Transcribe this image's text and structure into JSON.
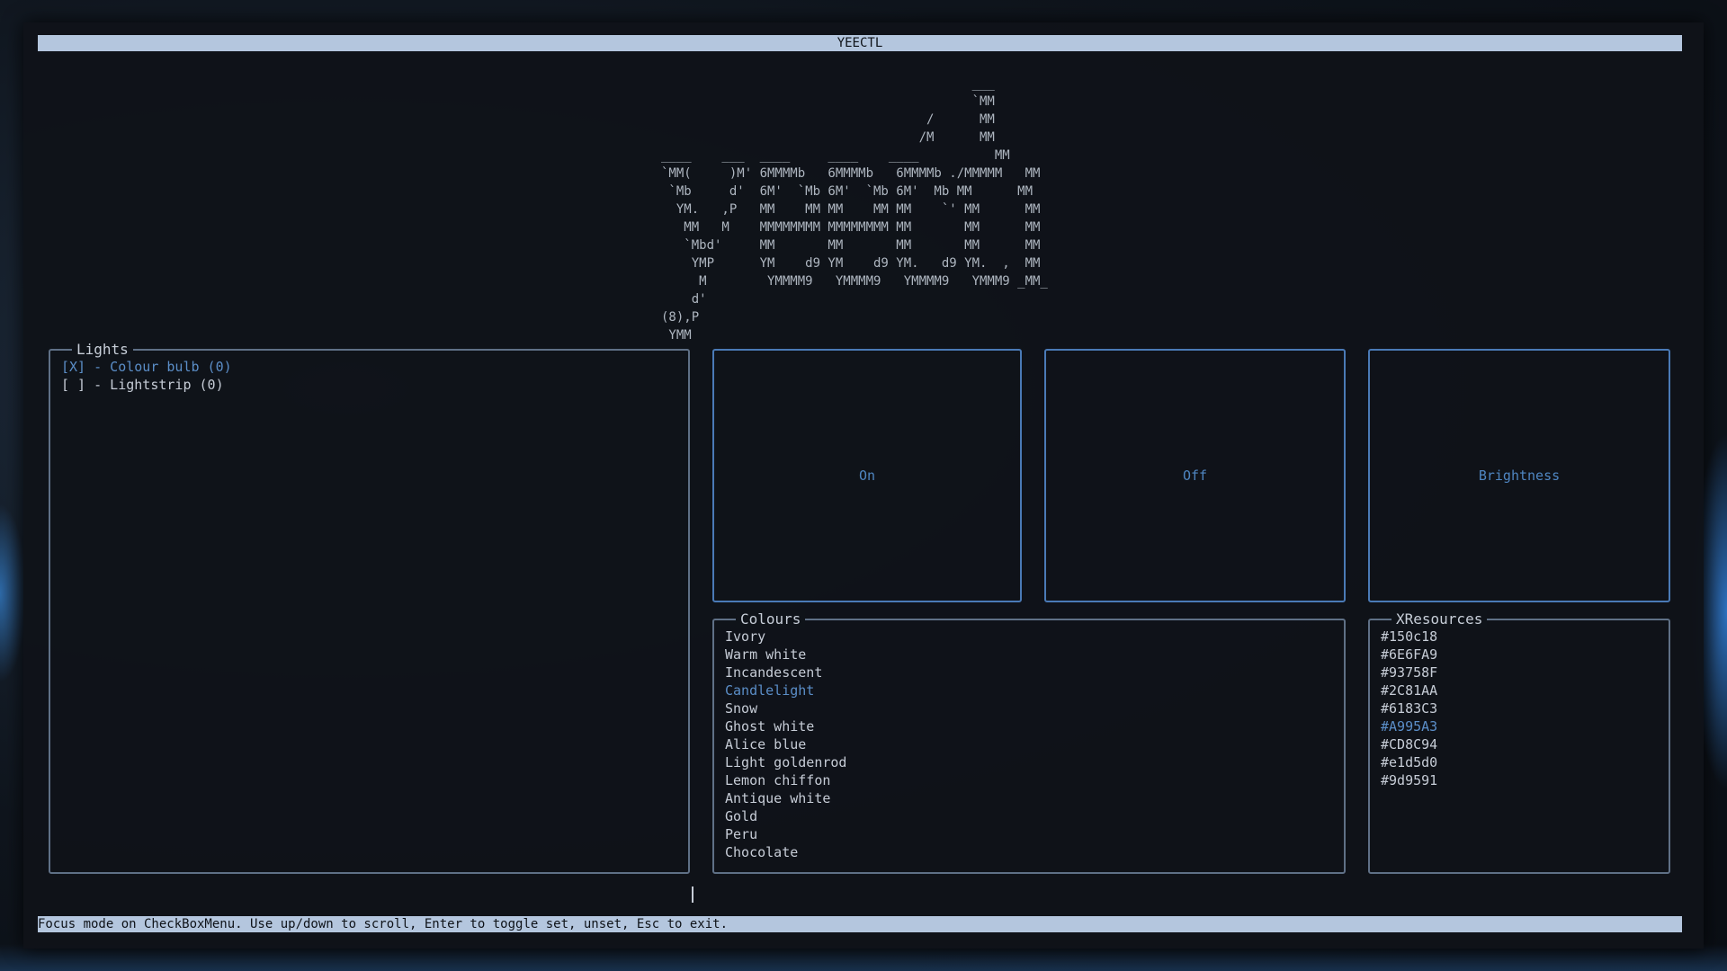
{
  "title": "YEECTL",
  "logo_ascii": "                                         ___\n                                         `MM\n                                   /      MM\n                                  /M      MM\n____    ___  ____     ____    ____          MM\n`MM(     )M' 6MMMMb   6MMMMb   6MMMMb ./MMMMM   MM\n `Mb     d'  6M'  `Mb 6M'  `Mb 6M'  Mb MM      MM\n  YM.   ,P   MM    MM MM    MM MM    `' MM      MM\n   MM   M    MMMMMMMM MMMMMMMM MM       MM      MM\n   `Mbd'     MM       MM       MM       MM      MM\n    YMP      YM    d9 YM    d9 YM.   d9 YM.  ,  MM\n     M        YMMMM9   YMMMM9   YMMMM9   YMMM9 _MM_\n    d'\n(8),P\n YMM",
  "lights": {
    "title": "Lights",
    "items": [
      {
        "label": "[X] - Colour bulb (0)",
        "selected": true
      },
      {
        "label": "[ ] - Lightstrip (0)",
        "selected": false
      }
    ]
  },
  "buttons": {
    "on": "On",
    "off": "Off",
    "brightness": "Brightness"
  },
  "colours": {
    "title": "Colours",
    "selected_index": 3,
    "items": [
      "Ivory",
      "Warm white",
      "Incandescent",
      "Candlelight",
      "Snow",
      "Ghost white",
      "Alice blue",
      "Light goldenrod",
      "Lemon chiffon",
      "Antique white",
      "Gold",
      "Peru",
      "Chocolate"
    ]
  },
  "xresources": {
    "title": "XResources",
    "selected_index": 5,
    "items": [
      "#150c18",
      "#6E6FA9",
      "#93758F",
      "#2C81AA",
      "#6183C3",
      "#A995A3",
      "#CD8C94",
      "#e1d5d0",
      "#9d9591"
    ]
  },
  "status": "Focus mode on CheckBoxMenu. Use up/down to scroll, Enter to toggle set, unset, Esc to exit.",
  "colors": {
    "bar_bg": "#b4c6de",
    "accent": "#4f86c2",
    "text": "#c6ccd6",
    "panel_border": "#5f7086",
    "button_border": "#4a7ab6"
  }
}
